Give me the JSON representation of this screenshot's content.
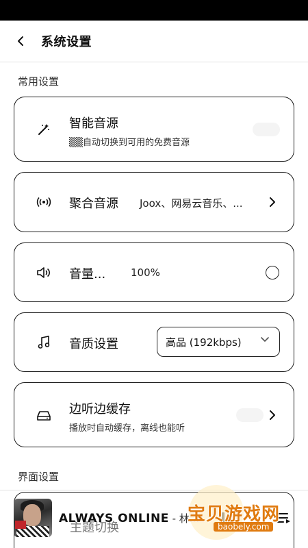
{
  "header": {
    "title": "系统设置"
  },
  "sections": {
    "common": "常用设置",
    "interface": "界面设置"
  },
  "settings": {
    "smart_source": {
      "title": "智能音源",
      "subtitle": "▒▒自动切换到可用的免费音源"
    },
    "aggregate_source": {
      "title": "聚合音源",
      "value": "Joox、网易云音乐、..."
    },
    "volume": {
      "title": "音量...",
      "value": "100%"
    },
    "quality": {
      "title": "音质设置",
      "selected": "高品 (192kbps)"
    },
    "cache": {
      "title": "边听边缓存",
      "subtitle": "播放时自动缓存，离线也能听"
    },
    "theme": {
      "title": "主题切换"
    }
  },
  "player": {
    "track": "ALWAYS ONLINE",
    "artist": " - 林..."
  },
  "watermark": {
    "text": "宝贝游戏网",
    "url": "baobely.com"
  },
  "icons": {
    "back": "chevron-left-icon",
    "smart": "magic-wand-icon",
    "aggregate": "broadcast-icon",
    "volume": "speaker-icon",
    "quality": "music-note-icon",
    "cache": "hard-drive-icon"
  }
}
